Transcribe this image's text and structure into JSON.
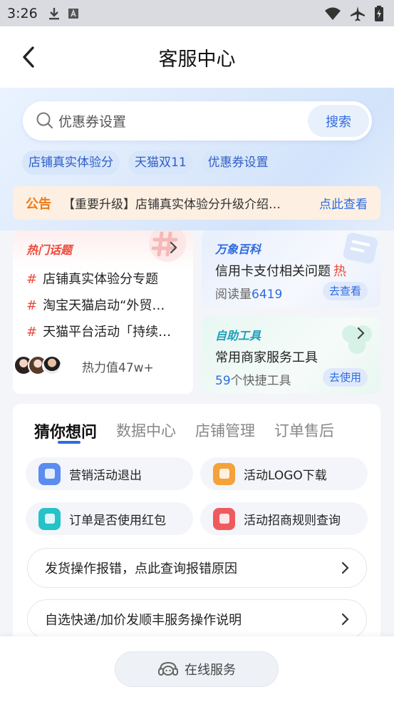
{
  "status_bar": {
    "time": "3:26"
  },
  "header": {
    "title": "客服中心"
  },
  "search": {
    "value": "优惠券设置",
    "button": "搜索"
  },
  "quick_tags": [
    "店铺真实体验分",
    "天猫双11",
    "优惠券设置"
  ],
  "notice": {
    "tag": "公告",
    "text": "【重要升级】店铺真实体验分升级介绍…",
    "link": "点此查看"
  },
  "hot_topics": {
    "title": "热门话题",
    "items": [
      "店铺真实体验分专题",
      "淘宝天猫启动“外贸…",
      "天猫平台活动「持续…"
    ],
    "hash": "#",
    "heat": "热力值47w+"
  },
  "wiki": {
    "title": "万象百科",
    "line": "信用卡支付相关问题",
    "hot": "热",
    "meta_label": "阅读量",
    "meta_value": "6419",
    "button": "去查看"
  },
  "tools": {
    "title": "自助工具",
    "line": "常用商家服务工具",
    "meta_value": "59",
    "meta_label": "个快捷工具",
    "button": "去使用"
  },
  "tabs": [
    "猜你想问",
    "数据中心",
    "店铺管理",
    "订单售后"
  ],
  "quick_questions": [
    "营销活动退出",
    "活动LOGO下载",
    "订单是否使用红包",
    "活动招商规则查询"
  ],
  "questions": [
    "发货操作报错，点此查询报错原因",
    "自选快递/加价发顺丰服务操作说明"
  ],
  "bottom": {
    "online_service": "在线服务"
  },
  "colors": {
    "accent": "#2f6be0",
    "hot": "#ec4a3a",
    "notice": "#ef7a1a"
  }
}
